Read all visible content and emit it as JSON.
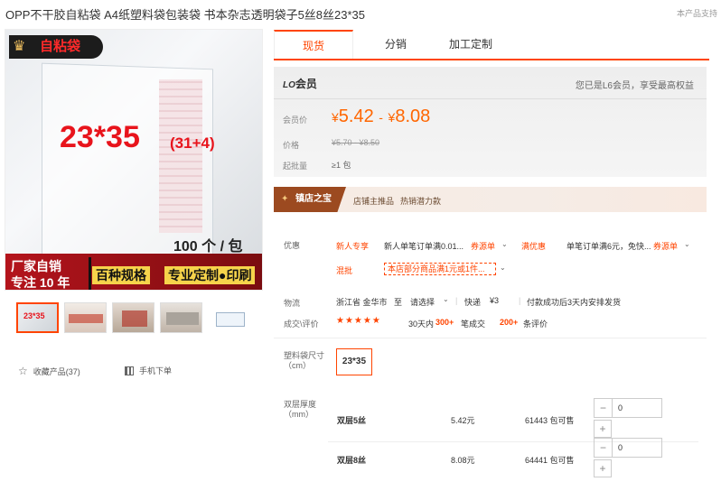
{
  "title": "OPP不干胶自粘袋 A4纸塑料袋包装袋 书本杂志透明袋子5丝8丝23*35",
  "top_right": "本产品支持",
  "product_image": {
    "tag": "自粘袋",
    "size": "23*35",
    "size_sub": "(31+4)",
    "count": "100 个 / 包",
    "band_line1": "厂家自销",
    "band_line2": "专注 10 年",
    "feature1": "百种规格",
    "feature2": "专业定制●印刷"
  },
  "thumbnails": {
    "first_label": "23*35"
  },
  "favorites": {
    "label": "收藏产品(37)",
    "icon": "star-outline-icon"
  },
  "mobile_order": {
    "label": "手机下单",
    "icon": "qrcode-icon"
  },
  "tabs": [
    "现货",
    "分销",
    "加工定制"
  ],
  "member": {
    "level_badge": "LO",
    "level_label": "会员",
    "note": "您已是L6会员，享受最高权益"
  },
  "price": {
    "member_label": "会员价",
    "member_low": "5.42",
    "member_high": "8.08",
    "currency": "¥",
    "dash": "-",
    "orig_label": "价格",
    "orig_range": "¥5.70 - ¥8.50",
    "min_label": "起批量",
    "min_value": "≥1 包"
  },
  "shop": {
    "badge": "镇店之宝",
    "text1": "店铺主推品",
    "text2": "热销潜力款"
  },
  "promos": {
    "label": "优惠",
    "tag1": "新人专享",
    "text1": "新人单笔订单满0.01...",
    "coupon1": "券源单",
    "tag2": "满优惠",
    "text2": "单笔订单满6元，免快...",
    "coupon2": "券源单",
    "tag3": "混批",
    "box": "本店部分商品满1元或1件..."
  },
  "logistics": {
    "label": "物流",
    "from": "浙江省 金华市",
    "to_prefix": "至",
    "to": "请选择",
    "fee_label": "快递",
    "fee": "¥3",
    "ship_note": "付款成功后3天内安排发货"
  },
  "reviews": {
    "label": "成交\\评价",
    "stars": "★★★★★",
    "deal_prefix": "30天内",
    "deals": "300+",
    "deal_suffix": "笔成交",
    "reviews": "200+",
    "review_suffix": "条评价"
  },
  "sku": {
    "size_label": "塑料袋尺寸（cm）",
    "size_option": "23*35",
    "thickness_label": "双层厚度（mm）",
    "rows": [
      {
        "name": "双层5丝",
        "price": "5.42元",
        "stock": "61443 包可售",
        "qty": "0"
      },
      {
        "name": "双层8丝",
        "price": "8.08元",
        "stock": "64441 包可售",
        "qty": "0"
      }
    ]
  },
  "colors": {
    "accent": "#ff4400",
    "price": "#ff6600",
    "shop_badge": "#9c4a20"
  }
}
